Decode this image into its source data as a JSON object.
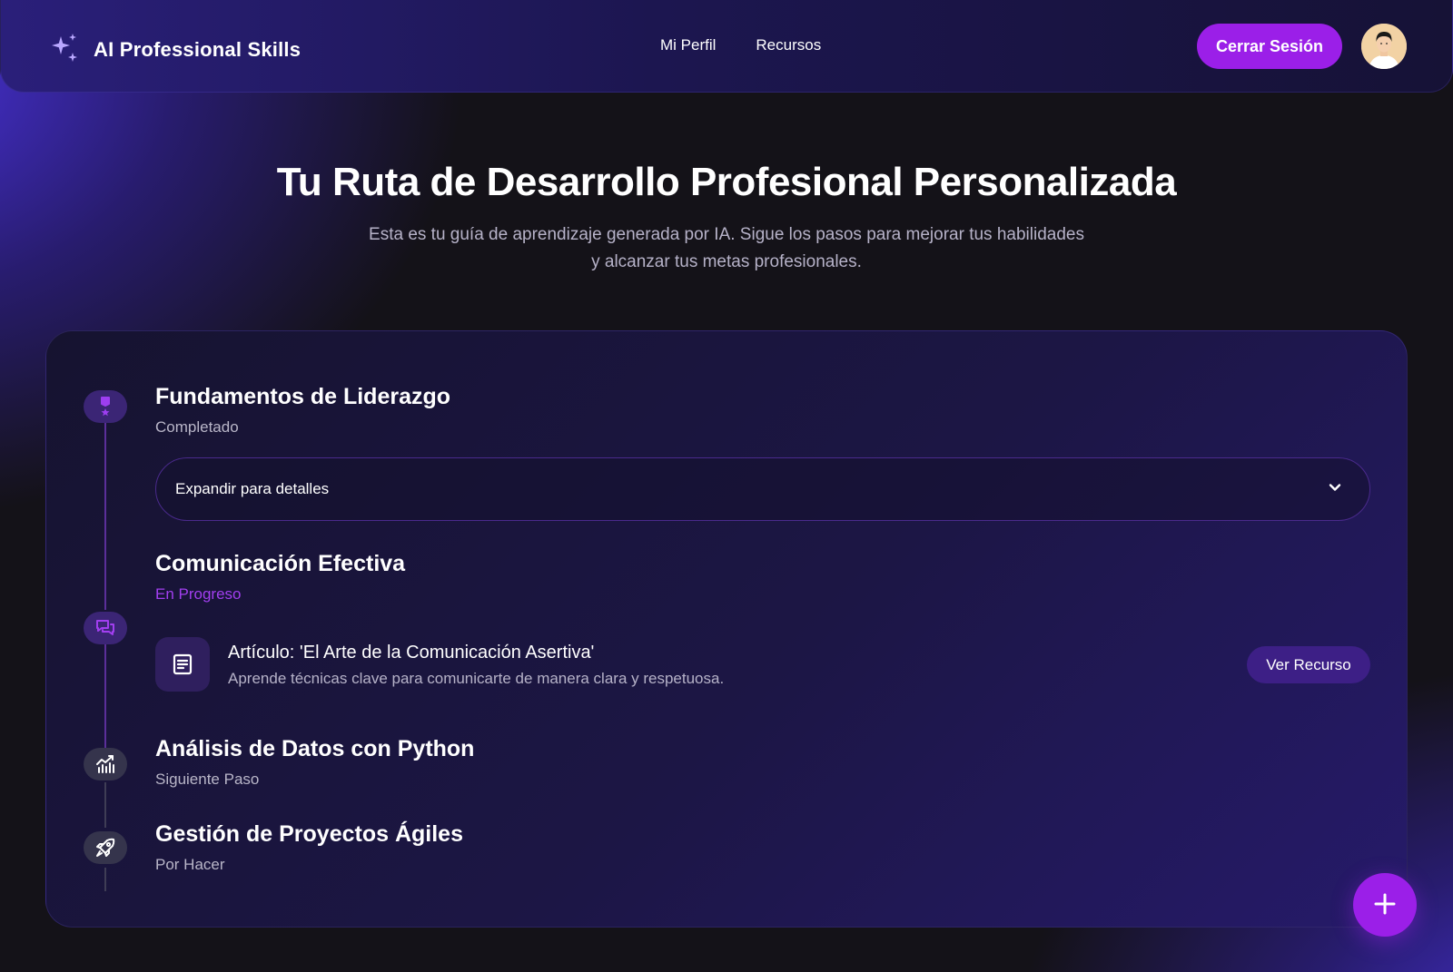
{
  "app": {
    "title": "AI Professional Skills",
    "logo_icon": "sparkles-icon"
  },
  "nav": {
    "items": [
      {
        "label": "Mi Perfil"
      },
      {
        "label": "Recursos"
      }
    ]
  },
  "header": {
    "logout_label": "Cerrar Sesión",
    "avatar_icon": "user-avatar"
  },
  "hero": {
    "title": "Tu Ruta de Desarrollo Profesional Personalizada",
    "subtitle_line1": "Esta es tu guía de aprendizaje generada por IA. Sigue los pasos para mejorar tus habilidades",
    "subtitle_line2": "y alcanzar tus metas profesionales."
  },
  "steps": [
    {
      "title": "Fundamentos de Liderazgo",
      "status": "Completado",
      "icon": "award-icon",
      "expander_label": "Expandir para detalles"
    },
    {
      "title": "Comunicación Efectiva",
      "status": "En Progreso",
      "icon": "chat-bubbles-icon",
      "resource": {
        "icon": "article-icon",
        "title": "Artículo: 'El Arte de la Comunicación Asertiva'",
        "description": "Aprende técnicas clave para comunicarte de manera clara y respetuosa.",
        "button_label": "Ver Recurso"
      }
    },
    {
      "title": "Análisis de Datos con Python",
      "status": "Siguiente Paso",
      "icon": "chart-icon"
    },
    {
      "title": "Gestión de Proyectos Ágiles",
      "status": "Por Hacer",
      "icon": "rocket-icon"
    }
  ],
  "fab": {
    "icon": "plus-icon"
  },
  "colors": {
    "accent": "#9b1fe8",
    "progress": "#a23ff0",
    "background": "#141218"
  }
}
